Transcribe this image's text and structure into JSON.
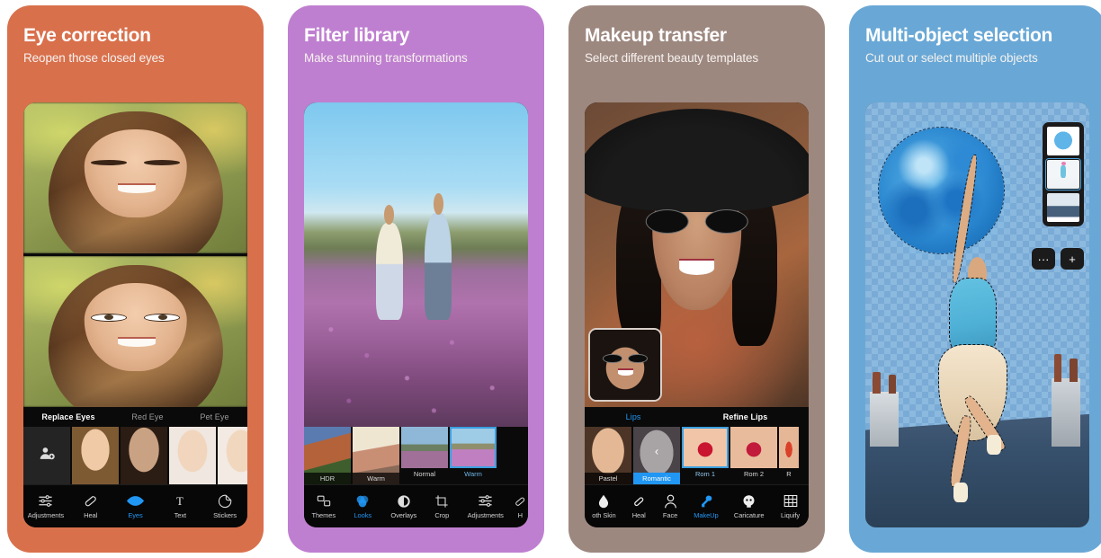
{
  "panels": [
    {
      "id": "eye-correction",
      "title": "Eye correction",
      "subtitle": "Reopen those closed eyes",
      "bg_color": "#d9704c",
      "tabs": [
        {
          "label": "Replace Eyes",
          "active": true
        },
        {
          "label": "Red Eye",
          "active": false
        },
        {
          "label": "Pet Eye",
          "active": false
        }
      ],
      "thumbnails": [
        {
          "label": "add-face",
          "icon": "add-person-icon"
        },
        {
          "label": "face-1"
        },
        {
          "label": "face-2"
        },
        {
          "label": "face-3"
        },
        {
          "label": "face-4"
        }
      ],
      "toolbar": [
        {
          "label": "Adjustments",
          "icon": "sliders-icon",
          "active": false
        },
        {
          "label": "Heal",
          "icon": "bandage-icon",
          "active": false
        },
        {
          "label": "Eyes",
          "icon": "eye-icon",
          "active": true
        },
        {
          "label": "Text",
          "icon": "text-icon",
          "active": false
        },
        {
          "label": "Stickers",
          "icon": "sticker-icon",
          "active": false
        }
      ]
    },
    {
      "id": "filter-library",
      "title": "Filter library",
      "subtitle": "Make stunning transformations",
      "bg_color": "#bf7fd0",
      "tabs": [],
      "thumbnails": [
        {
          "label": "HDR",
          "caption_inside": true,
          "selected": false
        },
        {
          "label": "Warm",
          "caption_inside": true,
          "selected": false
        },
        {
          "label": "Normal",
          "caption_inside": false,
          "selected": false
        },
        {
          "label": "Warm",
          "caption_inside": false,
          "selected": true
        }
      ],
      "toolbar": [
        {
          "label": "Themes",
          "icon": "themes-icon",
          "active": false
        },
        {
          "label": "Looks",
          "icon": "looks-icon",
          "active": true
        },
        {
          "label": "Overlays",
          "icon": "overlays-icon",
          "active": false
        },
        {
          "label": "Crop",
          "icon": "crop-icon",
          "active": false
        },
        {
          "label": "Adjustments",
          "icon": "sliders-icon",
          "active": false
        },
        {
          "label": "H",
          "icon": "heal-icon",
          "active": false
        }
      ]
    },
    {
      "id": "makeup-transfer",
      "title": "Makeup transfer",
      "subtitle": "Select different beauty templates",
      "bg_color": "#9d8880",
      "tabs": [
        {
          "label": "Lips",
          "active": true
        },
        {
          "label": "Refine Lips",
          "active": false
        }
      ],
      "thumbnails": [
        {
          "label": "Pastel",
          "selected": false,
          "highlight": false
        },
        {
          "label": "Romantic",
          "selected": false,
          "highlight": true
        },
        {
          "label": "Rom 1",
          "selected": true,
          "highlight": false
        },
        {
          "label": "Rom 2",
          "selected": false,
          "highlight": false
        },
        {
          "label": "R",
          "selected": false,
          "highlight": false
        }
      ],
      "toolbar": [
        {
          "label": "oth Skin",
          "icon": "droplet-icon",
          "active": false
        },
        {
          "label": "Heal",
          "icon": "bandage-icon",
          "active": false
        },
        {
          "label": "Face",
          "icon": "face-icon",
          "active": false
        },
        {
          "label": "MakeUp",
          "icon": "brush-icon",
          "active": true
        },
        {
          "label": "Caricature",
          "icon": "caricature-icon",
          "active": false
        },
        {
          "label": "Liquify",
          "icon": "grid-icon",
          "active": false
        }
      ]
    },
    {
      "id": "multi-object-selection",
      "title": "Multi-object selection",
      "subtitle": "Cut out or select multiple objects",
      "bg_color": "#69a8d6",
      "layers": [
        {
          "name": "moon-layer",
          "selected": false
        },
        {
          "name": "figure-layer",
          "selected": true
        },
        {
          "name": "rooftop-layer",
          "selected": false
        }
      ],
      "layer_buttons": [
        {
          "label": "···",
          "name": "more-options-button"
        },
        {
          "label": "+",
          "name": "add-layer-button"
        }
      ]
    }
  ]
}
